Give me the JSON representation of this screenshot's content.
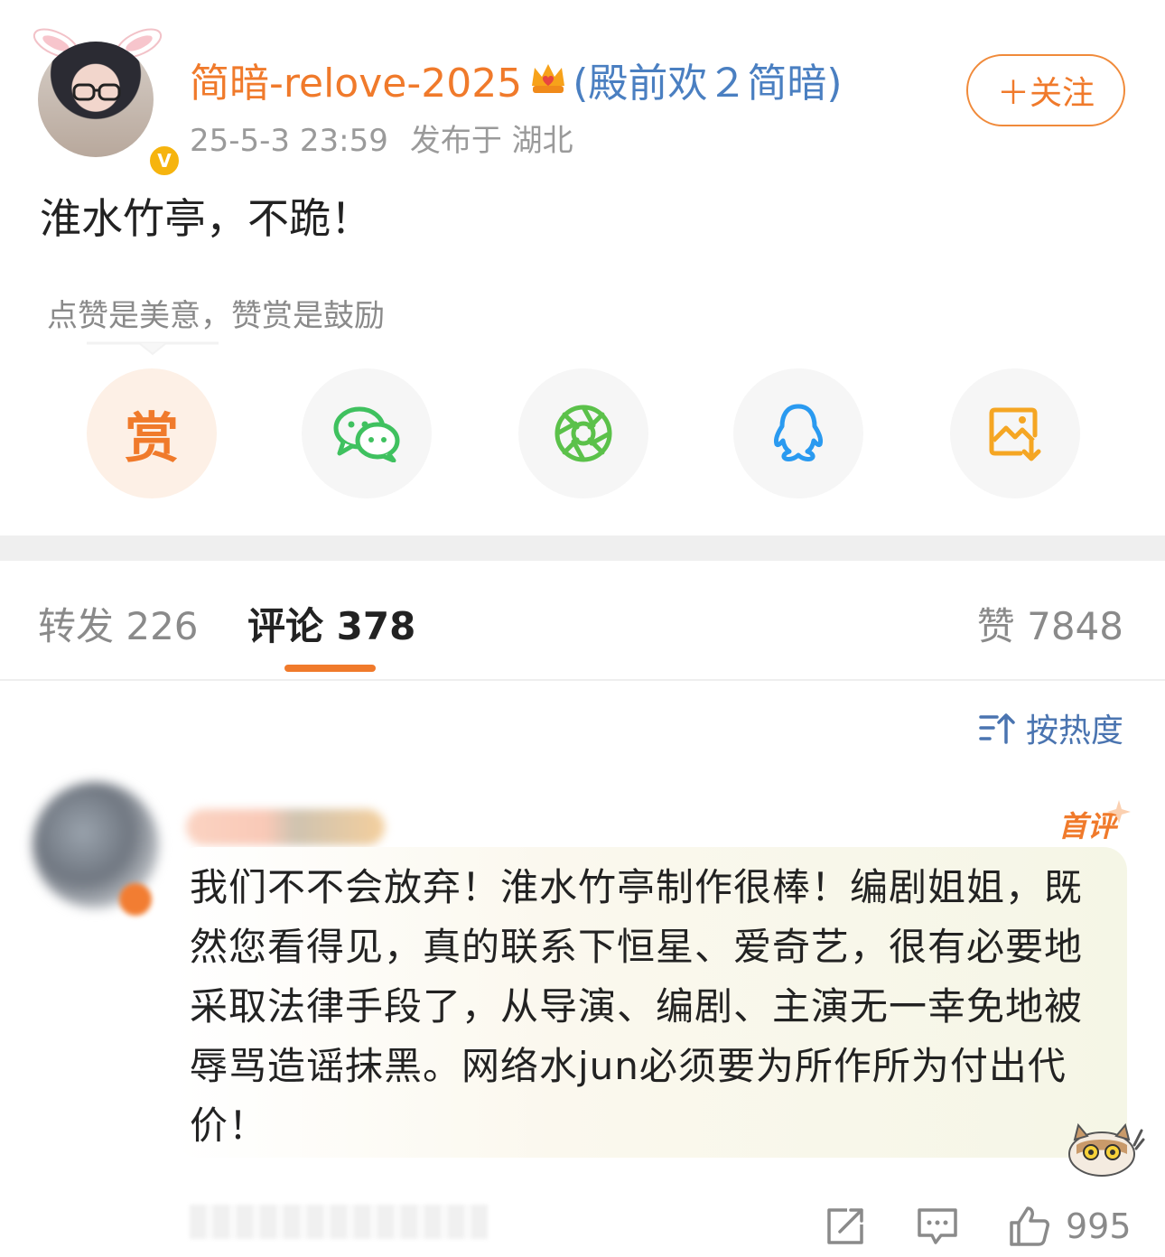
{
  "post": {
    "user_name": "简暗-relove-2025",
    "remark": "(殿前欢２简暗)",
    "timestamp": "25-5-3 23:59",
    "location": "发布于 湖北",
    "follow_label": "＋关注",
    "text": "淮水竹亭，不跪！",
    "verified_badge": "V"
  },
  "reward": {
    "tip": "点赞是美意，赞赏是鼓励",
    "reward_label": "赏"
  },
  "share_buttons": [
    {
      "name": "reward",
      "icon": "reward-icon"
    },
    {
      "name": "wechat",
      "icon": "wechat-icon"
    },
    {
      "name": "moments",
      "icon": "moments-icon"
    },
    {
      "name": "qq",
      "icon": "qq-icon"
    },
    {
      "name": "save-image",
      "icon": "save-image-icon"
    }
  ],
  "tabs": {
    "repost": "转发 226",
    "comment": "评论 378",
    "like": "赞 7848"
  },
  "sort": {
    "label": "按热度"
  },
  "comment": {
    "badge": "首评",
    "text": "我们不不会放弃！淮水竹亭制作很棒！编剧姐姐，既然您看得见，真的联系下恒星、爱奇艺，很有必要地采取法律手段了，从导演、编剧、主演无一幸免地被辱骂造谣抹黑。网络水jun必须要为所作所为付出代价！",
    "like_count": "995"
  },
  "colors": {
    "accent": "#f07a2b",
    "remark_blue": "#4a7fc1",
    "meta_gray": "#9a9a9a",
    "wechat_green": "#3fc15f",
    "qq_blue": "#2a9af0",
    "save_orange": "#f5a623"
  }
}
